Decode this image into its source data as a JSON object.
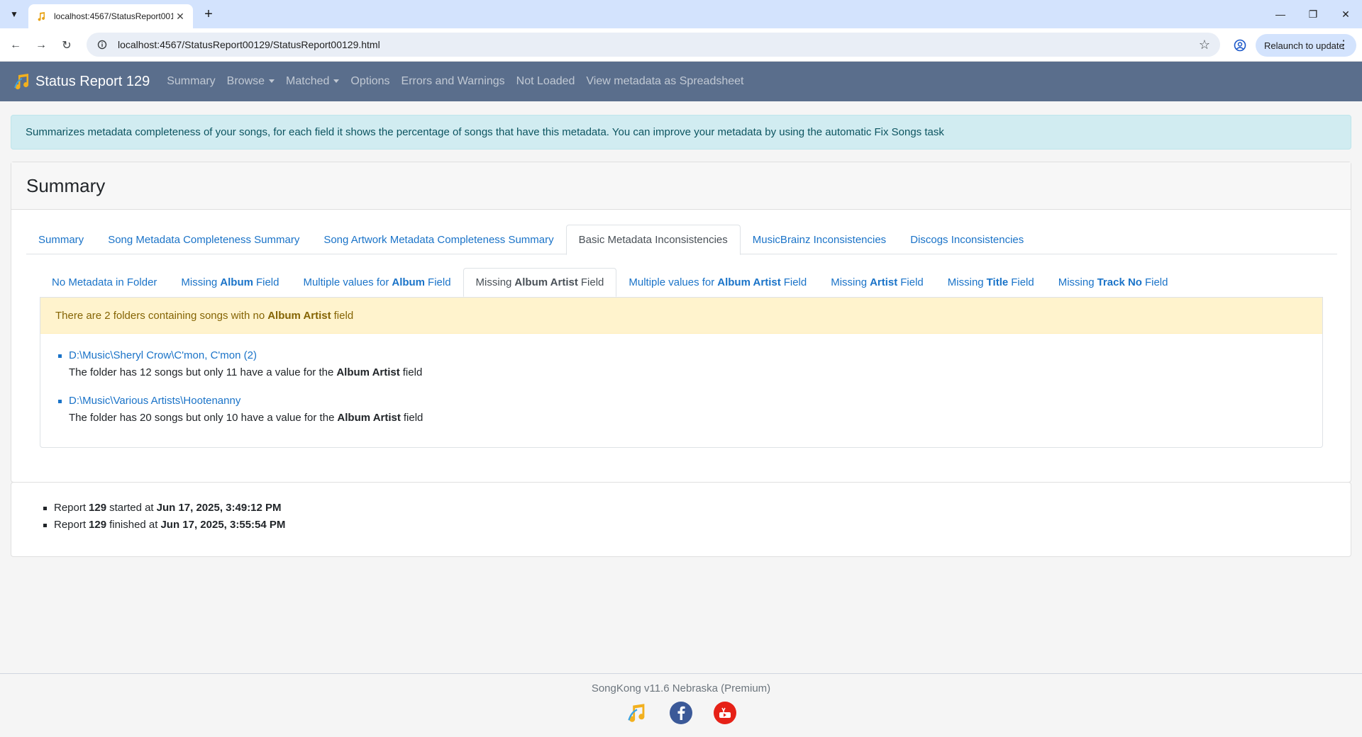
{
  "browser": {
    "tab_title": "localhost:4567/StatusReport00129/StatusReport00129.html",
    "url": "localhost:4567/StatusReport00129/StatusReport00129.html",
    "relaunch_label": "Relaunch to update"
  },
  "navbar": {
    "brand": "Status Report 129",
    "links": [
      "Summary",
      "Browse",
      "Matched",
      "Options",
      "Errors and Warnings",
      "Not Loaded",
      "View metadata as Spreadsheet"
    ]
  },
  "info_alert": "Summarizes metadata completeness of your songs, for each field it shows the percentage of songs that have this metadata. You can improve your metadata by using the automatic Fix Songs task",
  "card": {
    "title": "Summary",
    "tabs": [
      "Summary",
      "Song Metadata Completeness Summary",
      "Song Artwork Metadata Completeness Summary",
      "Basic Metadata Inconsistencies",
      "MusicBrainz Inconsistencies",
      "Discogs Inconsistencies"
    ],
    "active_tab": "Basic Metadata Inconsistencies",
    "subtabs": [
      {
        "pre": "No Metadata in Folder",
        "bold": "",
        "post": ""
      },
      {
        "pre": "Missing",
        "bold": "Album",
        "post": "Field"
      },
      {
        "pre": "Multiple values for",
        "bold": "Album",
        "post": "Field"
      },
      {
        "pre": "Missing",
        "bold": "Album Artist",
        "post": "Field"
      },
      {
        "pre": "Multiple values for",
        "bold": "Album Artist",
        "post": "Field"
      },
      {
        "pre": "Missing",
        "bold": "Artist",
        "post": "Field"
      },
      {
        "pre": "Missing",
        "bold": "Title",
        "post": "Field"
      },
      {
        "pre": "Missing",
        "bold": "Track No",
        "post": "Field"
      }
    ],
    "active_subtab": "Missing Album Artist Field",
    "warning": {
      "pre": "There are 2 folders containing songs with no",
      "bold": "Album Artist",
      "post": "field"
    },
    "folders": [
      {
        "path": "D:\\Music\\Sheryl Crow\\C'mon, C'mon (2)",
        "pre": "The folder has 12 songs but only 11 have a value for the",
        "bold": "Album Artist",
        "post": "field"
      },
      {
        "path": "D:\\Music\\Various Artists\\Hootenanny",
        "pre": "The folder has 20 songs but only 10 have a value for the",
        "bold": "Album Artist",
        "post": "field"
      }
    ]
  },
  "report": {
    "started": {
      "pre": "Report",
      "num": "129",
      "mid": "started at",
      "time": "Jun 17, 2025, 3:49:12 PM"
    },
    "finished": {
      "pre": "Report",
      "num": "129",
      "mid": "finished at",
      "time": "Jun 17, 2025, 3:55:54 PM"
    }
  },
  "footer": {
    "version": "SongKong v11.6 Nebraska (Premium)"
  },
  "colors": {
    "navbar": "#5a6e8c",
    "link": "#1a73c8",
    "info_bg": "#d1ecf1",
    "warning_bg": "#fff3cd"
  }
}
